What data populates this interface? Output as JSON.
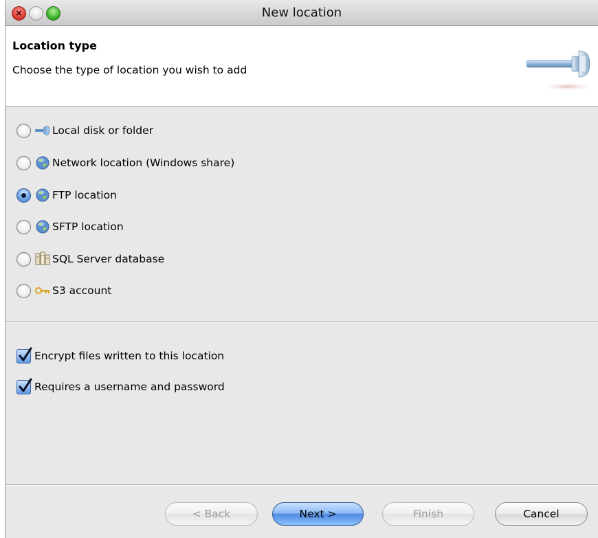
{
  "window": {
    "title": "New location"
  },
  "header": {
    "title": "Location type",
    "subtitle": "Choose the type of location you wish to add",
    "icon": "usb-connector-icon"
  },
  "location_types": [
    {
      "label": "Local disk or folder",
      "icon": "local-disk-icon",
      "selected": false
    },
    {
      "label": "Network location (Windows share)",
      "icon": "globe-icon",
      "selected": false
    },
    {
      "label": "FTP location",
      "icon": "globe-icon",
      "selected": true
    },
    {
      "label": "SFTP location",
      "icon": "globe-icon",
      "selected": false
    },
    {
      "label": "SQL Server database",
      "icon": "database-icon",
      "selected": false
    },
    {
      "label": "S3 account",
      "icon": "key-icon",
      "selected": false
    }
  ],
  "options": [
    {
      "label": "Encrypt files written to this location",
      "checked": true
    },
    {
      "label": "Requires a username and password",
      "checked": true
    }
  ],
  "buttons": {
    "back": "< Back",
    "next": "Next >",
    "finish": "Finish",
    "cancel": "Cancel"
  },
  "colors": {
    "accent": "#4f8be0",
    "window_bg": "#e8e8e8"
  }
}
